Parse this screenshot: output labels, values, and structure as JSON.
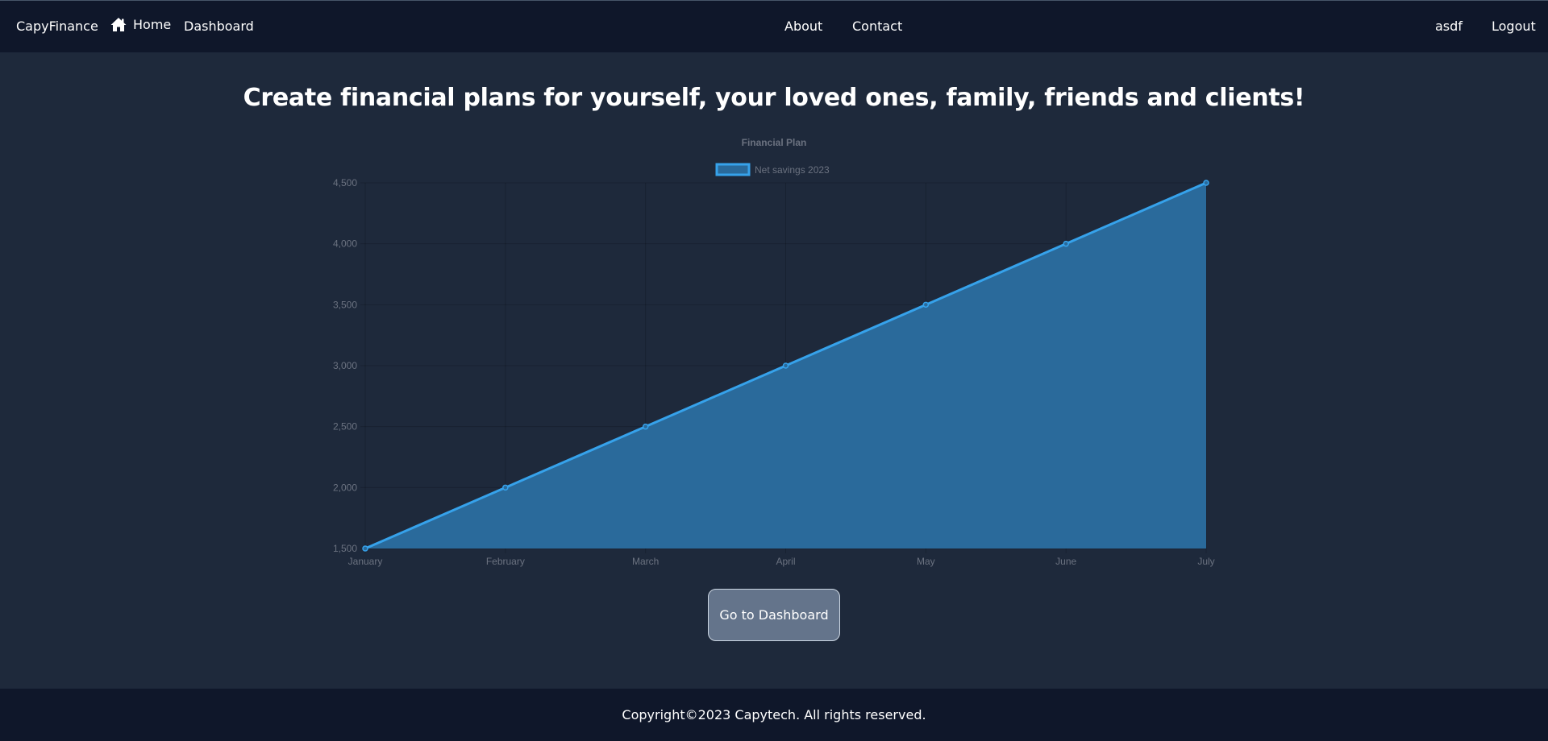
{
  "nav": {
    "brand": "CapyFinance",
    "home": "Home",
    "home_icon": "home-icon",
    "dashboard": "Dashboard",
    "about": "About",
    "contact": "Contact",
    "user": "asdf",
    "logout": "Logout"
  },
  "main": {
    "headline": "Create financial plans for yourself, your loved ones, family, friends and clients!",
    "cta_label": "Go to Dashboard"
  },
  "footer": {
    "text": "Copyright©2023 Capytech. All rights reserved."
  },
  "colors": {
    "background": "#1e293b",
    "navbar": "#0f172a",
    "line": "#36a2eb",
    "fill": "#2a6a9b",
    "tick": "#6b7280"
  },
  "chart_data": {
    "type": "area",
    "title": "Financial Plan",
    "categories": [
      "January",
      "February",
      "March",
      "April",
      "May",
      "June",
      "July"
    ],
    "series": [
      {
        "name": "Net savings 2023",
        "values": [
          1500,
          2000,
          2500,
          3000,
          3500,
          4000,
          4500
        ]
      }
    ],
    "ylim": [
      1500,
      4500
    ],
    "yticks": [
      1500,
      2000,
      2500,
      3000,
      3500,
      4000,
      4500
    ],
    "ytick_labels": [
      "1,500",
      "2,000",
      "2,500",
      "3,000",
      "3,500",
      "4,000",
      "4,500"
    ],
    "xlabel": "",
    "ylabel": "",
    "grid": true,
    "legend": "top-center"
  }
}
